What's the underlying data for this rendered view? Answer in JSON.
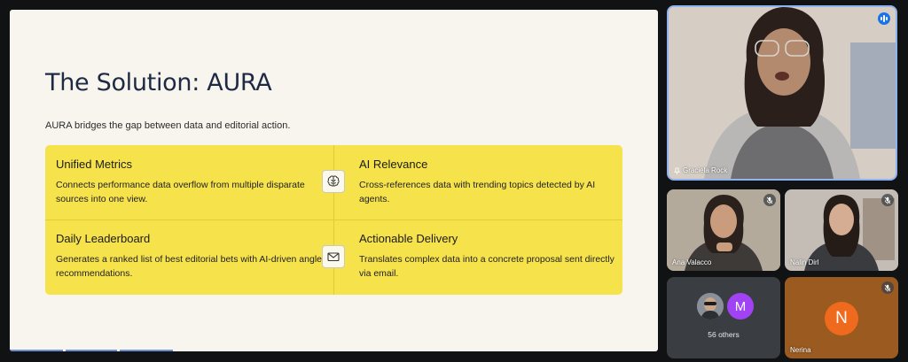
{
  "slide": {
    "title": "The Solution: AURA",
    "subtitle": "AURA bridges the gap between data and editorial action.",
    "cards": [
      {
        "title": "Unified Metrics",
        "body": "Connects performance data overflow from multiple disparate sources into one view."
      },
      {
        "title": "AI Relevance",
        "body": "Cross-references data with trending topics detected by AI agents."
      },
      {
        "title": "Daily Leaderboard",
        "body": "Generates a ranked list of best editorial bets with AI-driven angle recommendations."
      },
      {
        "title": "Actionable Delivery",
        "body": "Translates complex data into a concrete proposal sent directly via email."
      }
    ],
    "icons": [
      "brain-icon",
      "envelope-icon"
    ]
  },
  "participants": {
    "main": {
      "name": "Graciela Rock"
    },
    "tiles": [
      {
        "name": "Ana Valacco"
      },
      {
        "name": "Nalin Dirl"
      },
      {
        "avatar_letter": "M",
        "others_label": "56 others"
      },
      {
        "name": "Nerina",
        "avatar_letter": "N"
      }
    ]
  },
  "colors": {
    "slide_bg": "#f8f5ee",
    "card_yellow": "#f6e24a",
    "title_navy": "#1e2a44",
    "speaker_border": "#8fb2f0",
    "avatar_purple": "#a142f4",
    "avatar_orange": "#f06a1d"
  }
}
